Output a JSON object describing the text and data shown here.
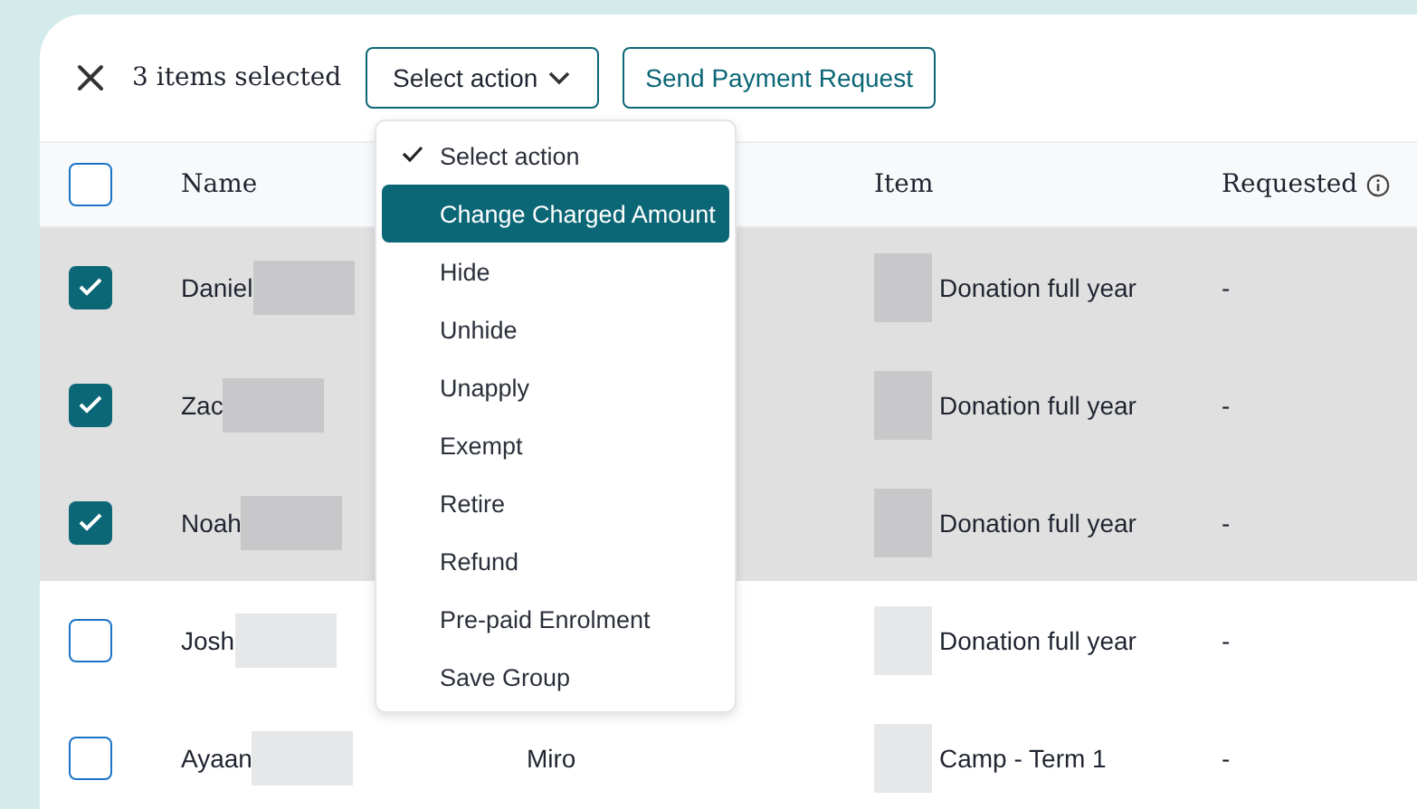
{
  "toolbar": {
    "selection_count": "3 items selected",
    "action_select": {
      "value": "Select action",
      "expanded": true
    },
    "send_button": "Send Payment Request"
  },
  "action_menu": [
    {
      "label": "Select action",
      "checked": true,
      "selected": false
    },
    {
      "label": "Change Charged Amount",
      "checked": false,
      "selected": true
    },
    {
      "label": "Hide",
      "checked": false,
      "selected": false
    },
    {
      "label": "Unhide",
      "checked": false,
      "selected": false
    },
    {
      "label": "Unapply",
      "checked": false,
      "selected": false
    },
    {
      "label": "Exempt",
      "checked": false,
      "selected": false
    },
    {
      "label": "Retire",
      "checked": false,
      "selected": false
    },
    {
      "label": "Refund",
      "checked": false,
      "selected": false
    },
    {
      "label": "Pre-paid Enrolment",
      "checked": false,
      "selected": false
    },
    {
      "label": "Save Group",
      "checked": false,
      "selected": false
    }
  ],
  "table": {
    "select_all": {
      "checked": false
    },
    "header": {
      "name": "Name",
      "item": "Item",
      "requested": "Requested"
    },
    "rows": [
      {
        "checked": true,
        "name": "Daniel",
        "item": "Donation full year",
        "requested": "-"
      },
      {
        "checked": true,
        "name": "Zac",
        "item": "Donation full year",
        "requested": "-"
      },
      {
        "checked": true,
        "name": "Noah",
        "item": "Donation full year",
        "requested": "-"
      },
      {
        "checked": false,
        "name": "Josh",
        "item": "Donation full year",
        "requested": "-"
      },
      {
        "checked": false,
        "name": "Ayaan",
        "column_3": "Miro",
        "item": "Camp - Term 1",
        "requested": "-"
      }
    ]
  }
}
